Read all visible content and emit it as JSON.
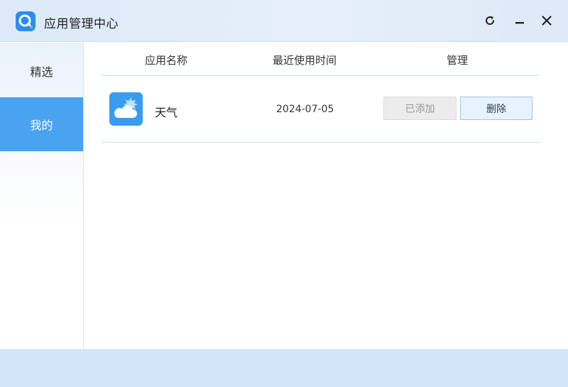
{
  "window": {
    "title": "应用管理中心"
  },
  "toolbar": {
    "refresh_icon": "refresh-icon",
    "minimize_icon": "minimize-icon",
    "close_icon": "close-icon"
  },
  "sidebar": {
    "items": [
      {
        "label": "精选",
        "active": false
      },
      {
        "label": "我的",
        "active": true
      }
    ]
  },
  "table": {
    "headers": [
      "应用名称",
      "最近使用时间",
      "管理"
    ],
    "rows": [
      {
        "icon": "weather-icon",
        "name": "天气",
        "last_used": "2024-07-05",
        "status_label": "已添加",
        "delete_label": "删除"
      }
    ]
  },
  "colors": {
    "accent": "#4aa3f0",
    "logo": "#2d8cf0",
    "footer": "#d2e5f9"
  }
}
